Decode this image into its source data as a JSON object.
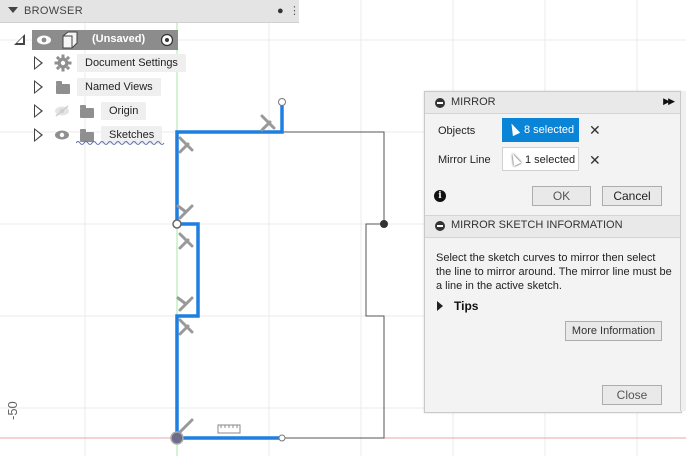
{
  "browser": {
    "title": "BROWSER",
    "root_label": "(Unsaved)",
    "items": [
      {
        "label": "Document Settings",
        "icon": "gear-icon"
      },
      {
        "label": "Named Views",
        "icon": "folder-icon"
      },
      {
        "label": "Origin",
        "icon": "folder-icon",
        "visibility": "hidden-eye-icon"
      },
      {
        "label": "Sketches",
        "icon": "folder-icon",
        "visibility": "eye-icon"
      }
    ]
  },
  "mirror": {
    "title": "MIRROR",
    "objects_label": "Objects",
    "objects_value": "8 selected",
    "mirror_line_label": "Mirror Line",
    "mirror_line_value": "1 selected",
    "ok_label": "OK",
    "cancel_label": "Cancel",
    "info_title": "MIRROR SKETCH INFORMATION",
    "description": "Select the sketch curves to mirror then select the line to mirror around. The mirror line must be a line in the active sketch.",
    "tips_label": "Tips",
    "more_info_label": "More Information",
    "close_label": "Close"
  },
  "canvas": {
    "axis_label": "-50"
  },
  "colors": {
    "selected_blue": "#1e7fe0",
    "objects_button_bg": "#0a84d6",
    "axis_red": "#e0a0a0",
    "axis_green": "#a6e8a6",
    "grid": "#ebebeb",
    "sketch_line": "#555555"
  }
}
